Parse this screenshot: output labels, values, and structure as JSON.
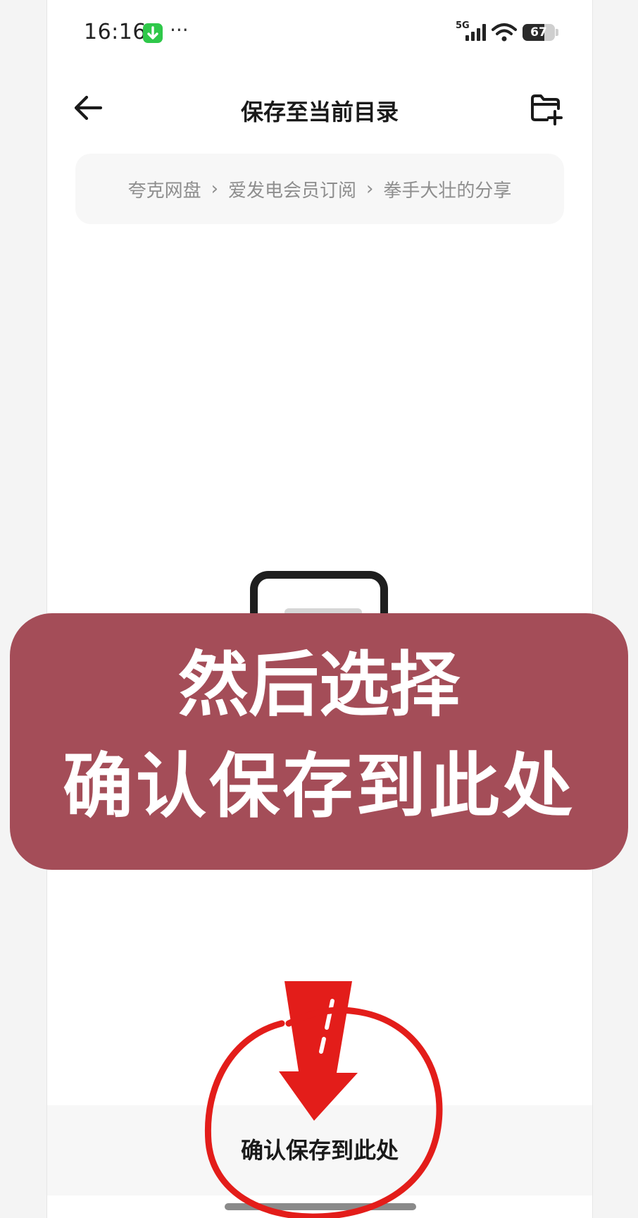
{
  "status_bar": {
    "time": "16:16",
    "dots": "···",
    "network": "5G",
    "battery_level": "67",
    "battery_fraction": 0.67
  },
  "header": {
    "title": "保存至当前目录",
    "back_icon": "arrow-left-icon",
    "action_icon": "folder-add-icon"
  },
  "breadcrumb": {
    "items": [
      "夸克网盘",
      "爱发电会员订阅",
      "拳手大壮的分享"
    ],
    "separator": "›"
  },
  "overlay": {
    "line1": "然后选择",
    "line2": "确认保存到此处",
    "color": "#a44d58"
  },
  "bottom": {
    "confirm_label": "确认保存到此处"
  },
  "colors": {
    "annotation_red": "#e31d1a",
    "download_badge": "#2fc84a"
  }
}
